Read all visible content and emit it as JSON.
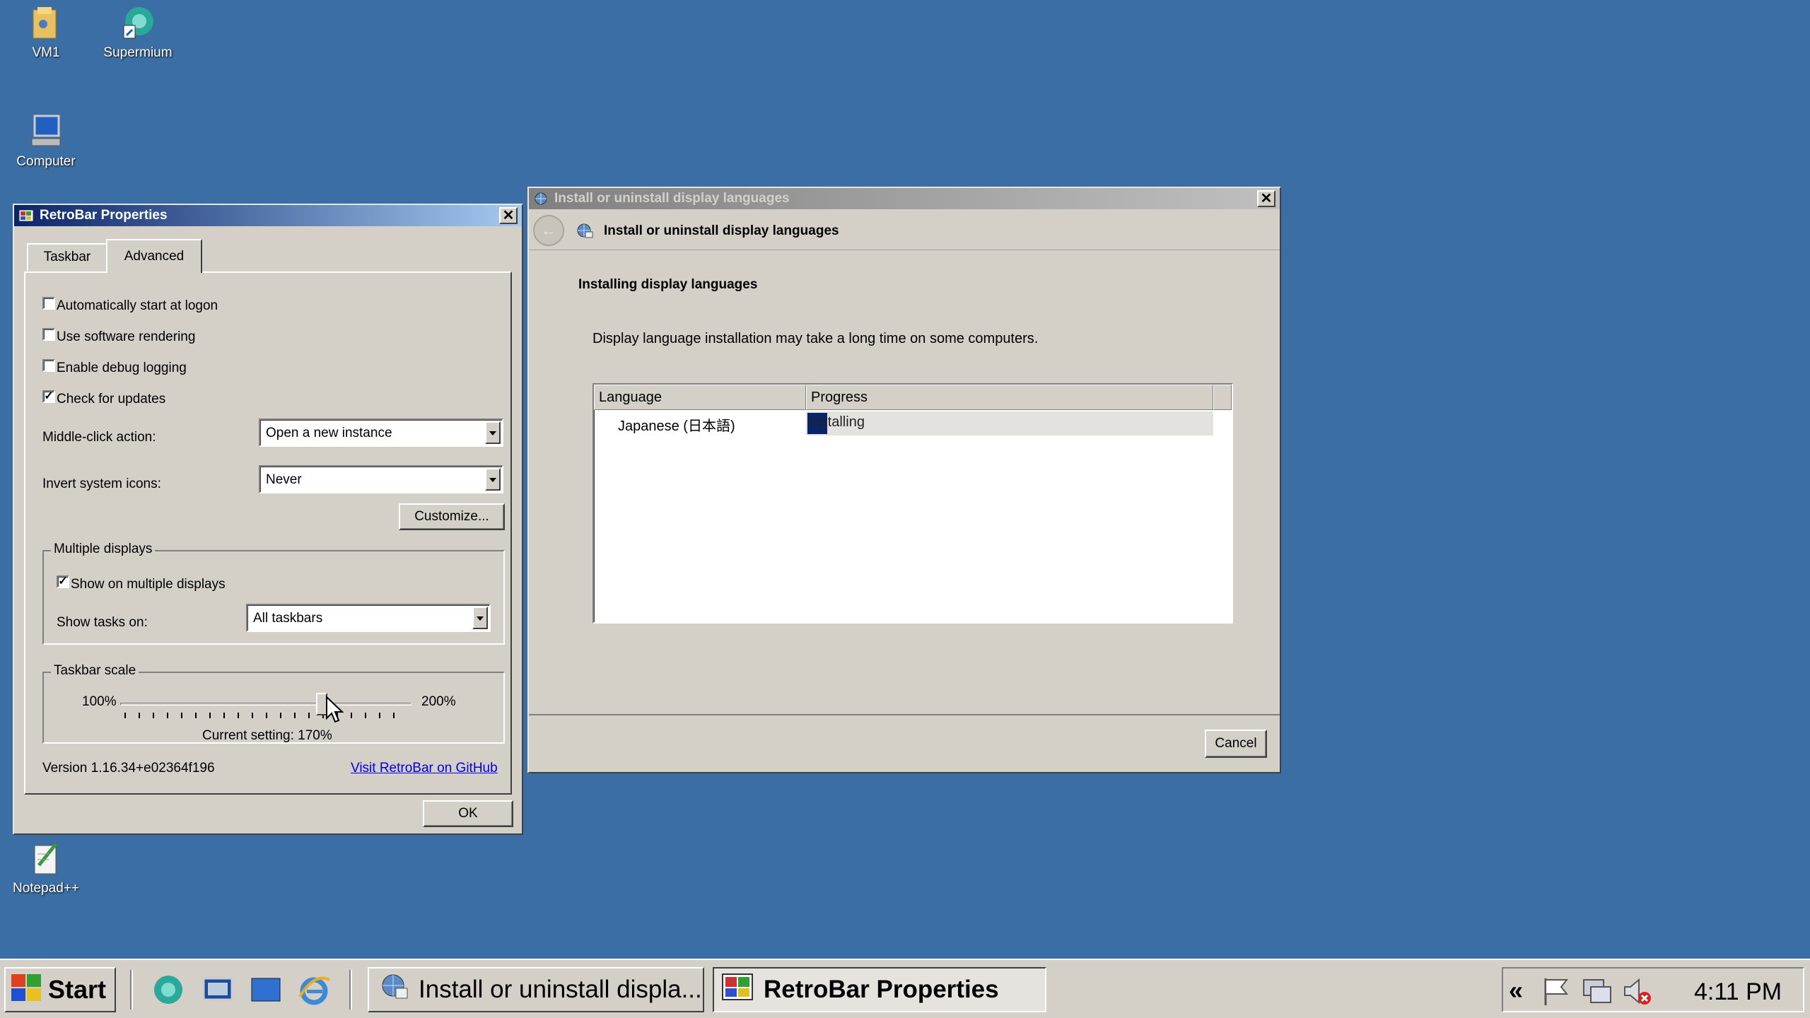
{
  "desktop": {
    "icons": [
      {
        "label": "VM1",
        "icon": "folder-icon"
      },
      {
        "label": "Supermium",
        "icon": "browser-icon"
      },
      {
        "label": "Computer",
        "icon": "computer-icon"
      },
      {
        "label": "Notepad++",
        "icon": "notepad-icon"
      }
    ]
  },
  "retrobar": {
    "title": "RetroBar Properties",
    "tabs": [
      "Taskbar",
      "Advanced"
    ],
    "active_tab": "Advanced",
    "checkboxes": [
      {
        "label": "Automatically start at logon",
        "checked": false
      },
      {
        "label": "Use software rendering",
        "checked": false
      },
      {
        "label": "Enable debug logging",
        "checked": false
      },
      {
        "label": "Check for updates",
        "checked": true
      }
    ],
    "middle_click_label": "Middle-click action:",
    "middle_click_value": "Open a new instance",
    "invert_label": "Invert system icons:",
    "invert_value": "Never",
    "customize_label": "Customize...",
    "multiple_displays": {
      "title": "Multiple displays",
      "show_label": "Show on multiple displays",
      "show_checked": true,
      "tasks_label": "Show tasks on:",
      "tasks_value": "All taskbars"
    },
    "scale": {
      "title": "Taskbar scale",
      "min_label": "100%",
      "max_label": "200%",
      "current_label": "Current setting: 170%",
      "value_fraction": 0.7
    },
    "version": "Version 1.16.34+e02364f196",
    "github_link": "Visit RetroBar on GitHub",
    "ok_label": "OK"
  },
  "langdlg": {
    "title": "Install or uninstall display languages",
    "header": "Install or uninstall display languages",
    "heading": "Installing display languages",
    "description": "Display language installation may take a long time on some computers.",
    "columns": [
      "Language",
      "Progress"
    ],
    "rows": [
      {
        "language": "Japanese (日本語)",
        "progress": "Installing"
      }
    ],
    "cancel_label": "Cancel"
  },
  "taskbar": {
    "start_label": "Start",
    "tasks": [
      {
        "label": "Install or uninstall displa...",
        "active": false
      },
      {
        "label": "RetroBar Properties",
        "active": true
      }
    ],
    "tray_chevron": "«",
    "clock": "4:11 PM"
  }
}
